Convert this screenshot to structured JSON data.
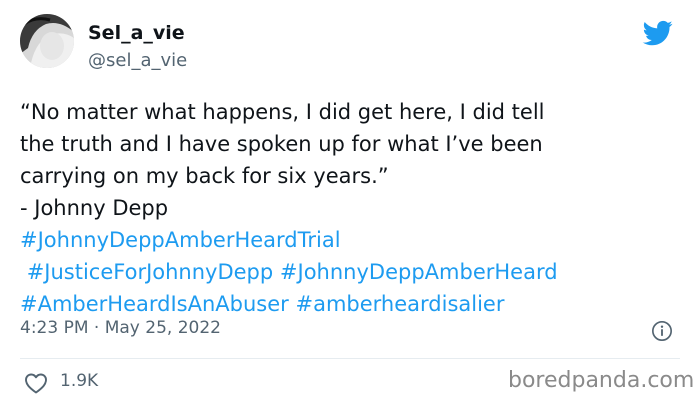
{
  "user": {
    "name": "Sel_a_vie",
    "handle": "@sel_a_vie"
  },
  "tweet": {
    "lines": [
      "“No matter what happens, I did get here, I did tell",
      "the truth and I have spoken up for what I’ve been",
      "carrying on my back for six years.”",
      "- Johnny Depp"
    ],
    "hashtags": [
      "#JohnnyDeppAmberHeardTrial",
      "#JusticeForJohnnyDepp",
      "#JohnnyDeppAmberHeard",
      "#AmberHeardIsAnAbuser",
      "#amberheardisalier"
    ]
  },
  "meta": {
    "timestamp": "4:23 PM · May 25, 2022"
  },
  "engagement": {
    "likes": "1.9K"
  },
  "watermark": "boredpanda.com",
  "icons": {
    "logo": "twitter-bird-icon",
    "info": "info-icon",
    "like": "heart-icon"
  },
  "colors": {
    "accent": "#1d9bf0",
    "text": "#0f1419",
    "muted": "#536471"
  }
}
